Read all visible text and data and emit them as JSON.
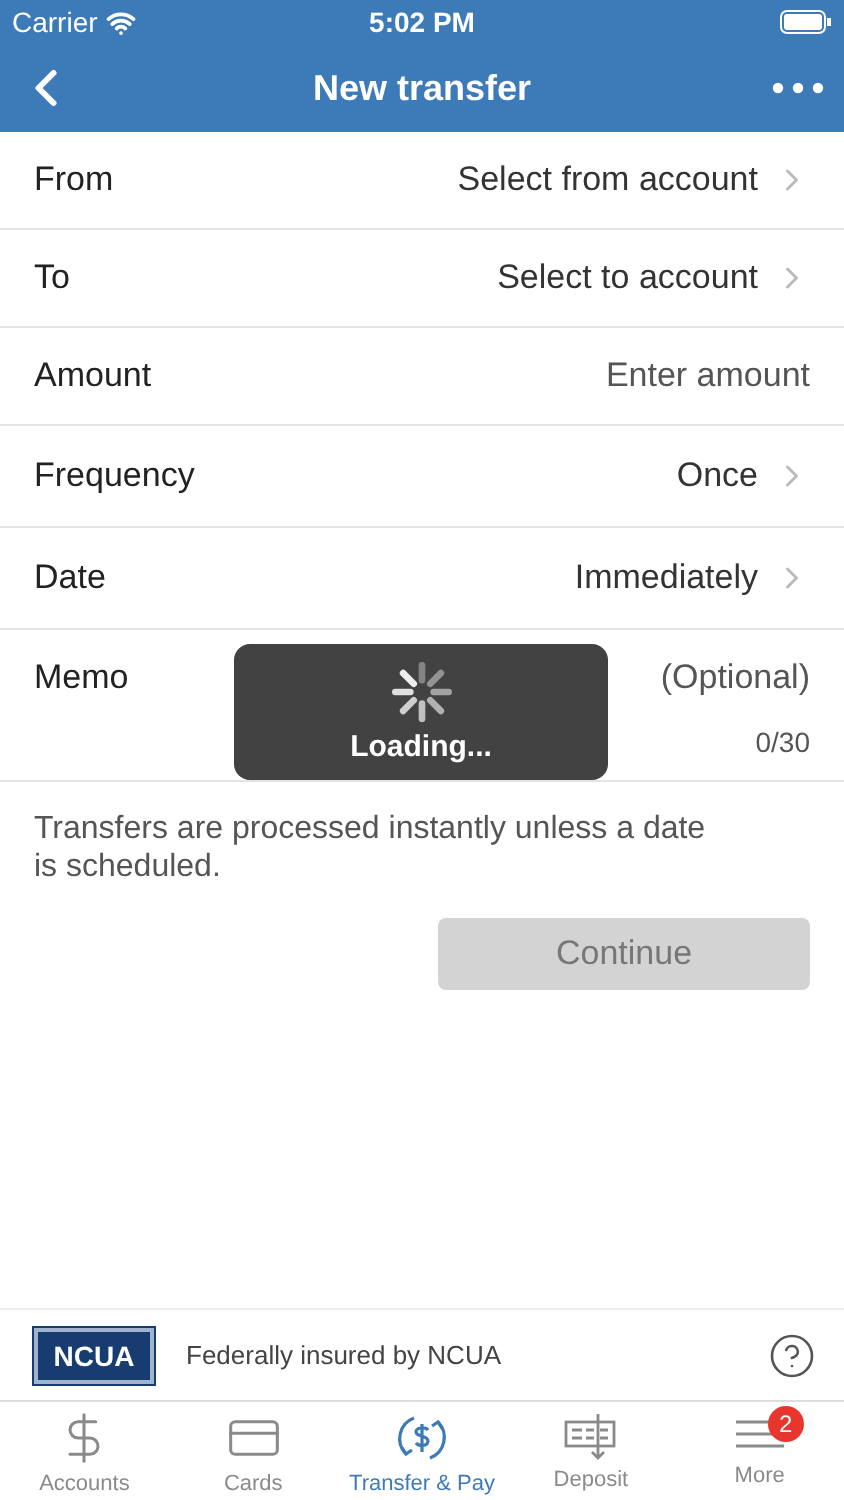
{
  "status_bar": {
    "carrier": "Carrier",
    "time": "5:02 PM"
  },
  "nav": {
    "title": "New transfer"
  },
  "form": [
    {
      "kind": "select",
      "label": "From",
      "value": "Select from account"
    },
    {
      "kind": "select",
      "label": "To",
      "value": "Select to account"
    },
    {
      "kind": "input",
      "label": "Amount",
      "placeholder": "Enter amount"
    },
    {
      "kind": "select",
      "label": "Frequency",
      "value": "Once"
    },
    {
      "kind": "select",
      "label": "Date",
      "value": "Immediately"
    },
    {
      "kind": "memo",
      "label": "Memo",
      "placeholder": "(Optional)",
      "counter": "0/30"
    }
  ],
  "note": "Transfers are processed instantly unless a date is scheduled.",
  "continue_button": {
    "label": "Continue",
    "disabled": true
  },
  "loading": {
    "label": "Loading..."
  },
  "footer": {
    "logo": "NCUA",
    "text": "Federally insured by NCUA"
  },
  "tabs": [
    {
      "label": "Accounts",
      "selected": false
    },
    {
      "label": "Cards",
      "selected": false
    },
    {
      "label": "Transfer & Pay",
      "selected": true
    },
    {
      "label": "Deposit",
      "selected": false
    },
    {
      "label": "More",
      "selected": false,
      "badge": "2"
    }
  ]
}
